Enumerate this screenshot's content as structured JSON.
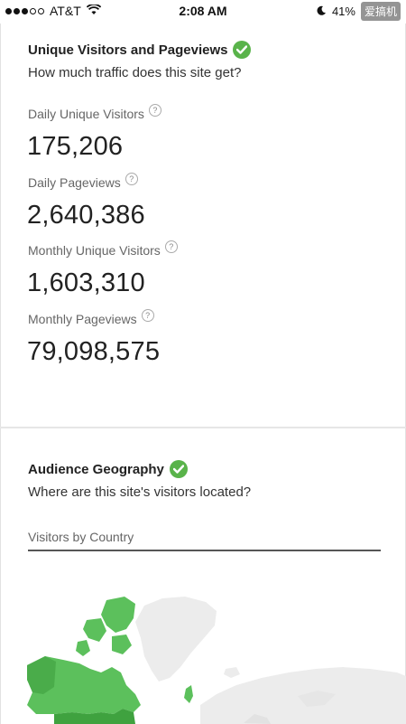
{
  "status_bar": {
    "carrier": "AT&T",
    "time": "2:08 AM",
    "battery": "41%",
    "watermark": "爱搞机"
  },
  "traffic": {
    "title": "Unique Visitors and Pageviews",
    "subtitle": "How much traffic does this site get?",
    "metrics": [
      {
        "label": "Daily Unique Visitors",
        "value": "175,206"
      },
      {
        "label": "Daily Pageviews",
        "value": "2,640,386"
      },
      {
        "label": "Monthly Unique Visitors",
        "value": "1,603,310"
      },
      {
        "label": "Monthly Pageviews",
        "value": "79,098,575"
      }
    ]
  },
  "geography": {
    "title": "Audience Geography",
    "subtitle": "Where are this site's visitors located?",
    "tab_label": "Visitors by Country"
  },
  "colors": {
    "check_green": "#59b34a",
    "map_highlight": "#5cc05c",
    "map_base": "#ececec"
  }
}
